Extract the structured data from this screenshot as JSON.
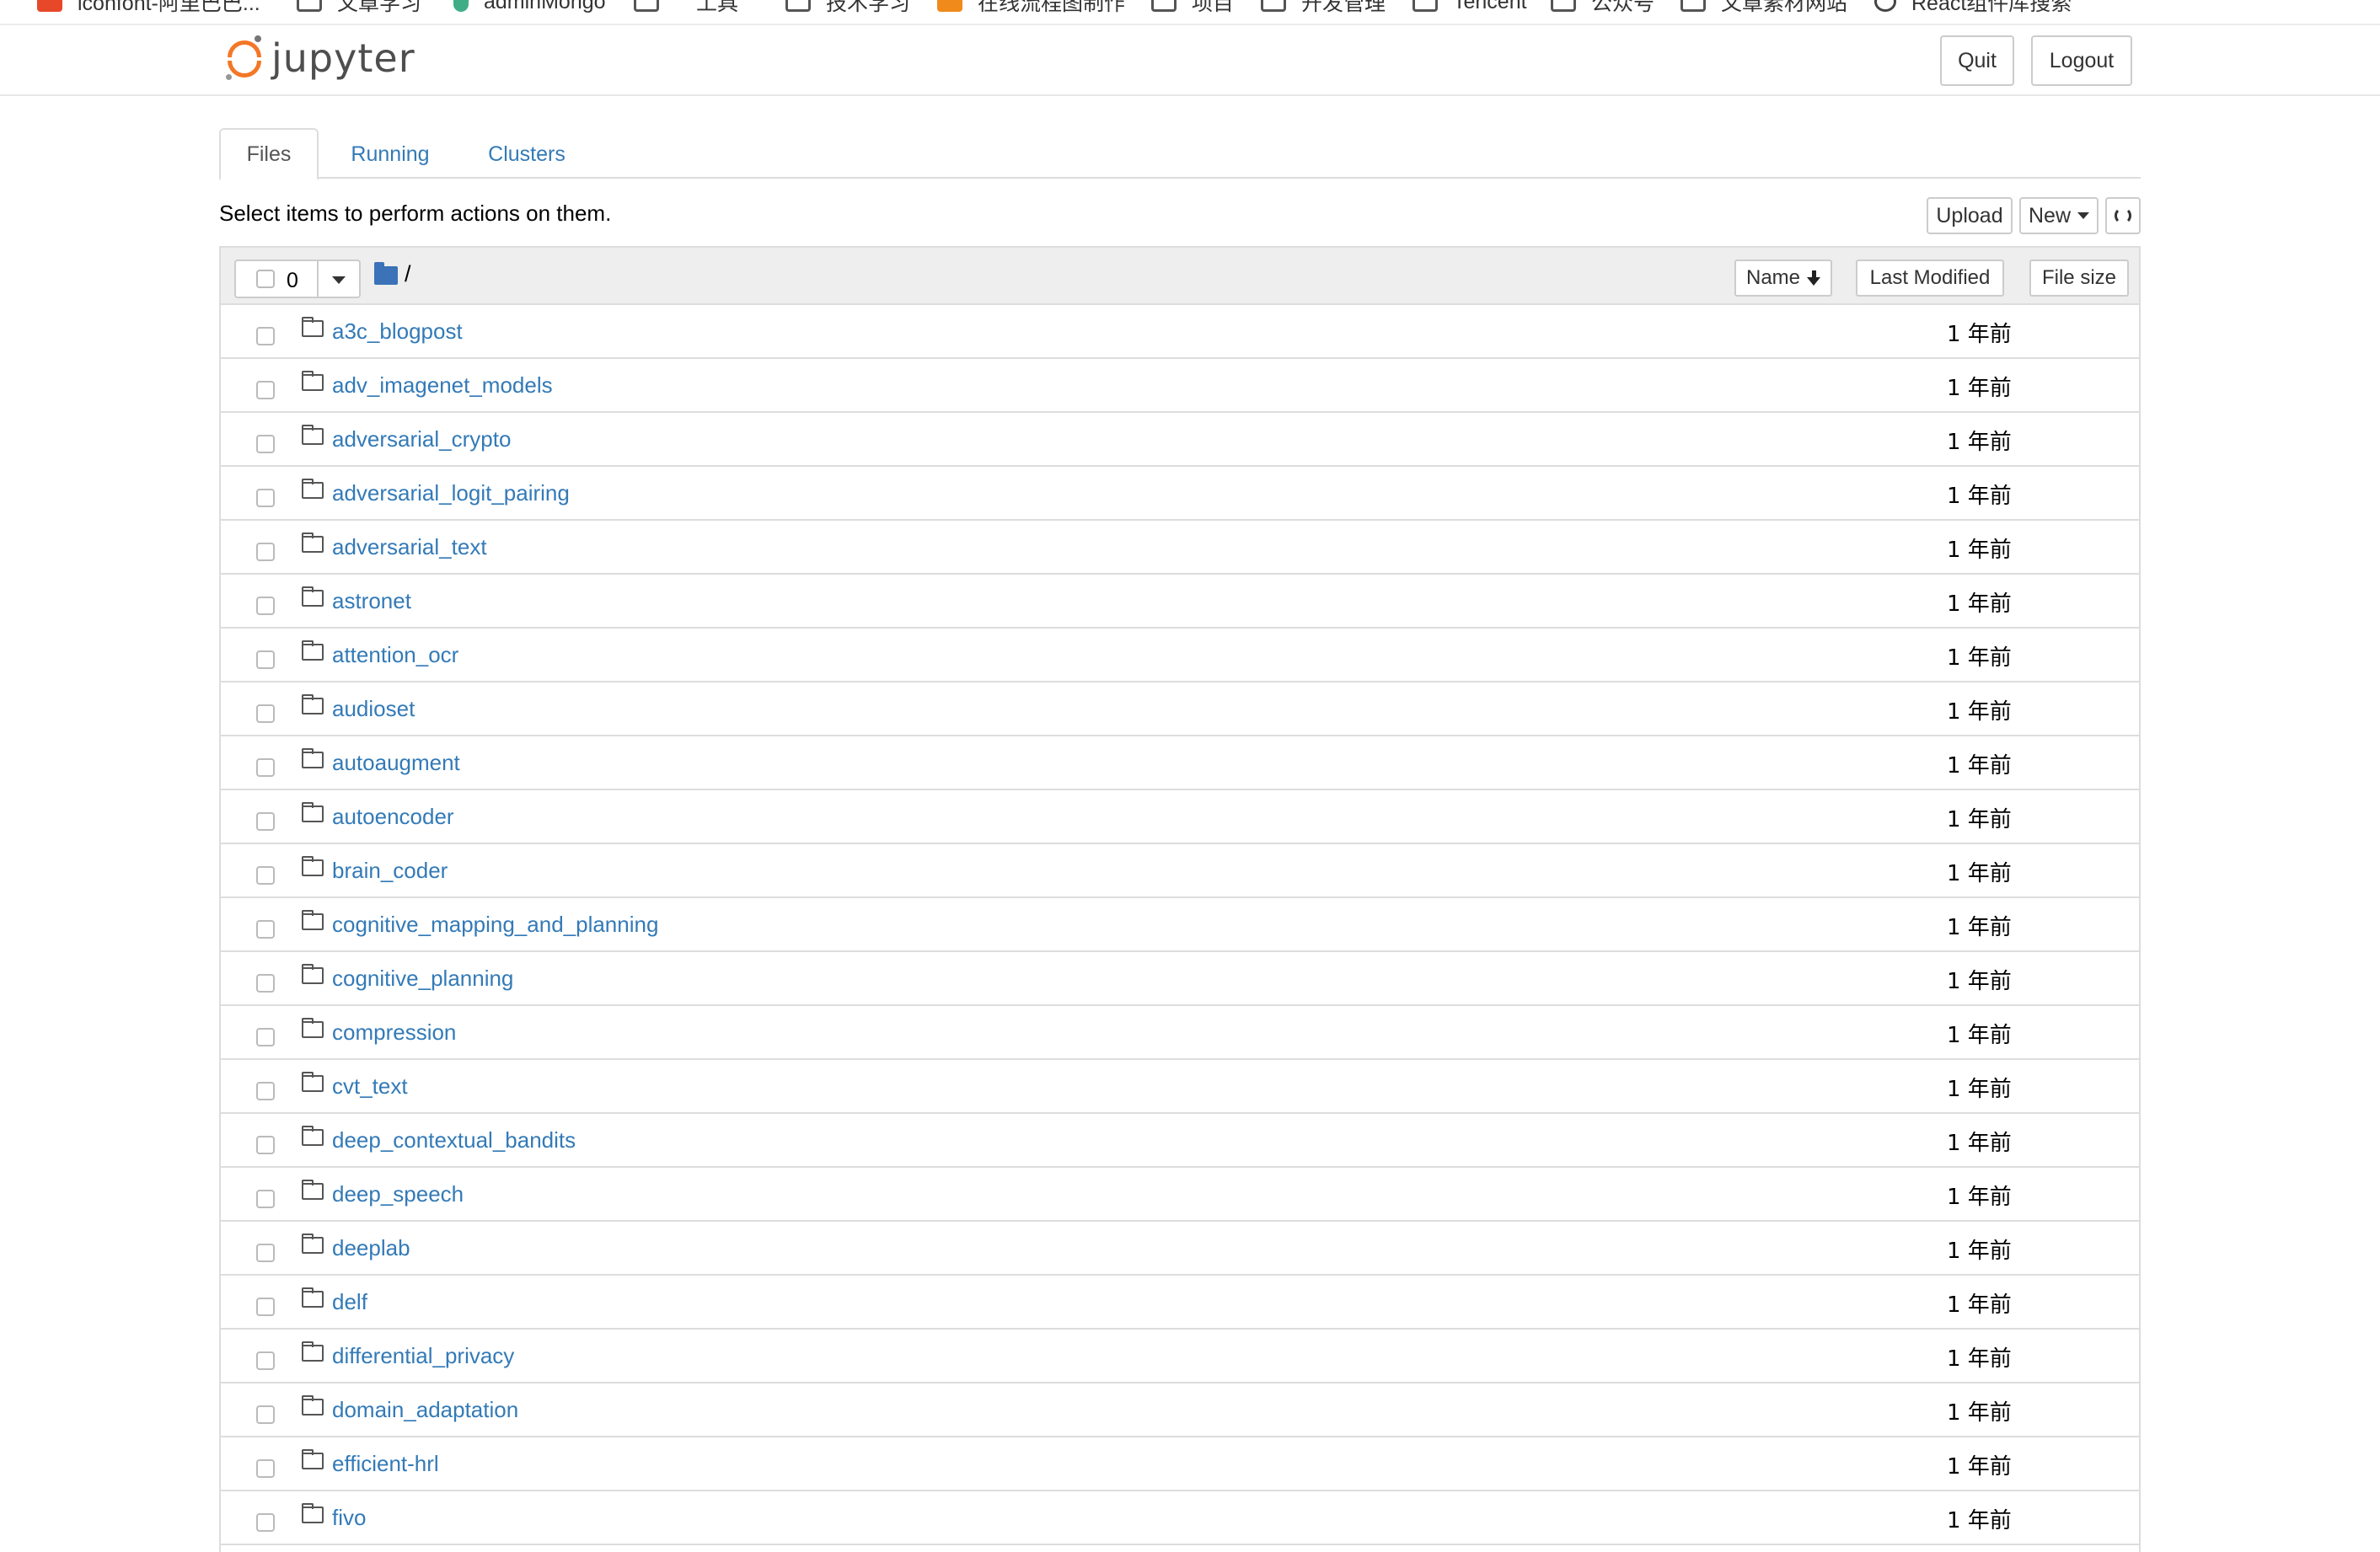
{
  "bookmarks": [
    {
      "label": "iconfont-阿里巴巴...",
      "icon": "iconfont-icon"
    },
    {
      "label": "文章学习",
      "icon": "folder-icon"
    },
    {
      "label": "adminMongo",
      "icon": "vue-icon"
    },
    {
      "label": "",
      "icon": "folder-icon"
    },
    {
      "label": "工具",
      "icon": "folder-icon"
    },
    {
      "label": "技术学习",
      "icon": "folder-icon"
    },
    {
      "label": "在线流程图制作",
      "icon": "processon-icon"
    },
    {
      "label": "项目",
      "icon": "folder-icon"
    },
    {
      "label": "开发管理",
      "icon": "folder-icon"
    },
    {
      "label": "Tencent",
      "icon": "folder-icon"
    },
    {
      "label": "公众号",
      "icon": "folder-icon"
    },
    {
      "label": "文章素材网站",
      "icon": "folder-icon"
    },
    {
      "label": "React组件库搜索",
      "icon": "react-icon"
    }
  ],
  "header": {
    "logo_text": "jupyter",
    "quit_label": "Quit",
    "logout_label": "Logout"
  },
  "tabs": [
    {
      "label": "Files",
      "active": true
    },
    {
      "label": "Running",
      "active": false
    },
    {
      "label": "Clusters",
      "active": false
    }
  ],
  "toolbar": {
    "instructions": "Select items to perform actions on them.",
    "upload_label": "Upload",
    "new_label": "New"
  },
  "list_header": {
    "selected_count": "0",
    "path": "/",
    "sort_name": "Name",
    "sort_modified": "Last Modified",
    "sort_size": "File size"
  },
  "rows": [
    {
      "name": "a3c_blogpost",
      "modified": "1 年前"
    },
    {
      "name": "adv_imagenet_models",
      "modified": "1 年前"
    },
    {
      "name": "adversarial_crypto",
      "modified": "1 年前"
    },
    {
      "name": "adversarial_logit_pairing",
      "modified": "1 年前"
    },
    {
      "name": "adversarial_text",
      "modified": "1 年前"
    },
    {
      "name": "astronet",
      "modified": "1 年前"
    },
    {
      "name": "attention_ocr",
      "modified": "1 年前"
    },
    {
      "name": "audioset",
      "modified": "1 年前"
    },
    {
      "name": "autoaugment",
      "modified": "1 年前"
    },
    {
      "name": "autoencoder",
      "modified": "1 年前"
    },
    {
      "name": "brain_coder",
      "modified": "1 年前"
    },
    {
      "name": "cognitive_mapping_and_planning",
      "modified": "1 年前"
    },
    {
      "name": "cognitive_planning",
      "modified": "1 年前"
    },
    {
      "name": "compression",
      "modified": "1 年前"
    },
    {
      "name": "cvt_text",
      "modified": "1 年前"
    },
    {
      "name": "deep_contextual_bandits",
      "modified": "1 年前"
    },
    {
      "name": "deep_speech",
      "modified": "1 年前"
    },
    {
      "name": "deeplab",
      "modified": "1 年前"
    },
    {
      "name": "delf",
      "modified": "1 年前"
    },
    {
      "name": "differential_privacy",
      "modified": "1 年前"
    },
    {
      "name": "domain_adaptation",
      "modified": "1 年前"
    },
    {
      "name": "efficient-hrl",
      "modified": "1 年前"
    },
    {
      "name": "fivo",
      "modified": "1 年前"
    }
  ],
  "colors": {
    "link": "#337ab7",
    "jupyter_orange": "#f37726",
    "header_bg": "#eeeeee",
    "border": "#dddddd"
  }
}
